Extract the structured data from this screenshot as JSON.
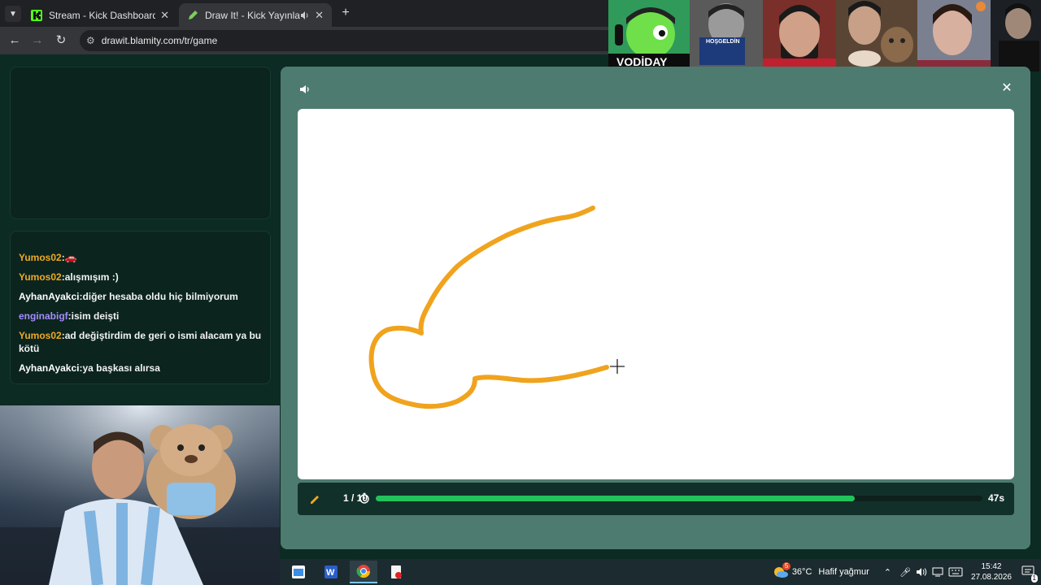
{
  "browser": {
    "tabs": [
      {
        "title": "Stream - Kick Dashboard",
        "close": "✕"
      },
      {
        "title": "Draw It! - Kick Yayınları İçin",
        "close": "✕"
      }
    ],
    "new_tab": "+",
    "url": "drawit.blamity.com/tr/game"
  },
  "chat": {
    "messages": [
      {
        "user": "Yumos02",
        "text": "🚗",
        "color": "#f0a923"
      },
      {
        "user": "Yumos02",
        "text": "alışmışım :)",
        "color": "#f0a923"
      },
      {
        "user": "AyhanAyakci",
        "text": "diğer hesaba oldu hiç bilmiyorum",
        "color": "#ffffff"
      },
      {
        "user": "enginabigf",
        "text": "isim deişti",
        "color": "#a58cff"
      },
      {
        "user": "Yumos02",
        "text": "ad değiştirdim de geri o ismi alacam ya bu kötü",
        "color": "#f0a923"
      },
      {
        "user": "AyhanAyakci",
        "text": "ya başkası alırsa",
        "color": "#ffffff"
      }
    ]
  },
  "webcam": {
    "top_label": "VODİDAY",
    "welcome_sign": "HOŞGELDİN"
  },
  "game": {
    "round": "1 / 10",
    "time_left": "47s",
    "progress_fraction": 0.79,
    "stroke_color": "#f0a31d",
    "background": "#4e7b6f"
  },
  "taskbar": {
    "weather_temp": "36°C",
    "weather_desc": "Hafif yağmur",
    "weather_badge": "5",
    "time": "15:42",
    "date": "27.08.2026",
    "notif_count": "1"
  }
}
